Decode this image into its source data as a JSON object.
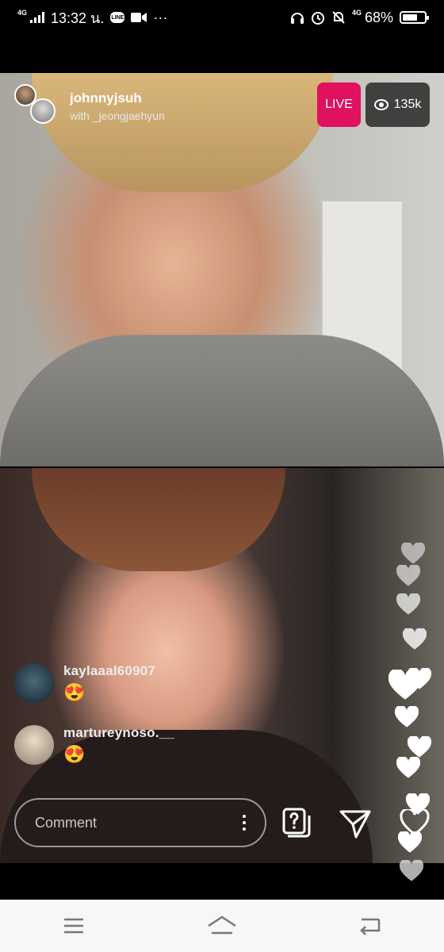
{
  "status_bar": {
    "network": "4G",
    "time": "13:32 น.",
    "line_label": "LINE",
    "more": "···",
    "network_right": "4G",
    "battery": "68%",
    "battery_level": 0.68
  },
  "broadcast": {
    "host": "johnnyjsuh",
    "guest_line": "with _jeongjaehyun",
    "live_label": "LIVE",
    "viewer_count": "135k"
  },
  "comments": [
    {
      "user": "kaylaaal60907",
      "text": "😍"
    },
    {
      "user": "martureynoso.__",
      "text": "😍"
    }
  ],
  "composer": {
    "placeholder": "Comment"
  },
  "colors": {
    "live": "#e0115f",
    "heart": "#ffffff",
    "nav_bar": "#f7f7f7"
  }
}
